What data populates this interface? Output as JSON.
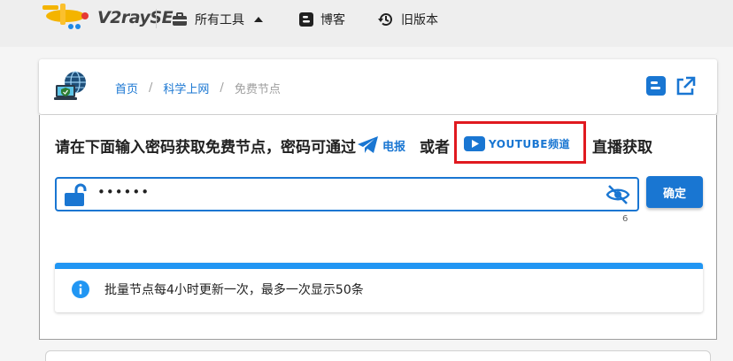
{
  "nav": {
    "brand": "V2raySE",
    "tools_label": "所有工具",
    "blog_label": "博客",
    "old_label": "旧版本"
  },
  "breadcrumb": {
    "home": "首页",
    "science": "科学上网",
    "current": "免费节点",
    "separator": "/"
  },
  "main": {
    "prompt": "请在下面输入密码获取免费节点，密码可通过",
    "telegram_label": "电报",
    "or_text": "或者",
    "youtube_label": "YOUTUBE频道",
    "tail_text": "直播获取",
    "password_value": "••••••",
    "password_counter": "6",
    "confirm_label": "确定",
    "alert_text": "批量节点每4小时更新一次，最多一次显示50条"
  },
  "colors": {
    "primary": "#1976d2",
    "highlight": "#e0191f",
    "alert_border": "#2196f3"
  }
}
